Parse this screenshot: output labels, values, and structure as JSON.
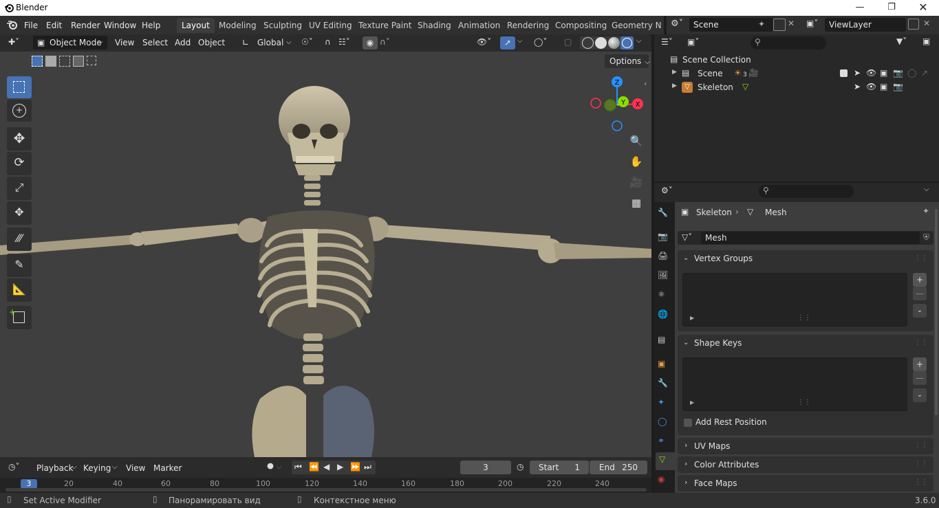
{
  "window": {
    "title": "Blender"
  },
  "menubar": {
    "items": [
      "File",
      "Edit",
      "Render",
      "Window",
      "Help"
    ],
    "workspaces": [
      "Layout",
      "Modeling",
      "Sculpting",
      "UV Editing",
      "Texture Paint",
      "Shading",
      "Animation",
      "Rendering",
      "Compositing",
      "Geometry Noc"
    ],
    "scene": "Scene",
    "view_layer": "ViewLayer"
  },
  "viewport_header": {
    "mode": "Object Mode",
    "menus": [
      "View",
      "Select",
      "Add",
      "Object"
    ],
    "orientation": "Global",
    "options": "Options"
  },
  "gizmo": {
    "z": "Z",
    "y": "Y",
    "x": "X"
  },
  "outliner": {
    "root": "Scene Collection",
    "items": [
      {
        "label": "Scene",
        "badge": "3"
      },
      {
        "label": "Skeleton"
      }
    ]
  },
  "properties": {
    "breadcrumb": [
      "Skeleton",
      "Mesh"
    ],
    "mesh_name": "Mesh",
    "panels": {
      "vertex_groups": "Vertex Groups",
      "shape_keys": "Shape Keys",
      "add_rest_position": "Add Rest Position",
      "uv_maps": "UV Maps",
      "color_attributes": "Color Attributes",
      "face_maps": "Face Maps"
    }
  },
  "timeline": {
    "menus": [
      "Playback",
      "Keying",
      "View",
      "Marker"
    ],
    "current_frame": "3",
    "start_label": "Start",
    "start": "1",
    "end_label": "End",
    "end": "250",
    "ticks": [
      "20",
      "40",
      "60",
      "80",
      "100",
      "120",
      "140",
      "160",
      "180",
      "200",
      "220",
      "240"
    ]
  },
  "statusbar": {
    "left": "Set Active Modifier",
    "middle": "Панорамировать вид",
    "right": "Контекстное меню",
    "version": "3.6.0"
  },
  "colors": {
    "accent": "#4772b3",
    "x_axis": "#ff3352",
    "y_axis": "#8bdc00",
    "z_axis": "#2890ff"
  }
}
